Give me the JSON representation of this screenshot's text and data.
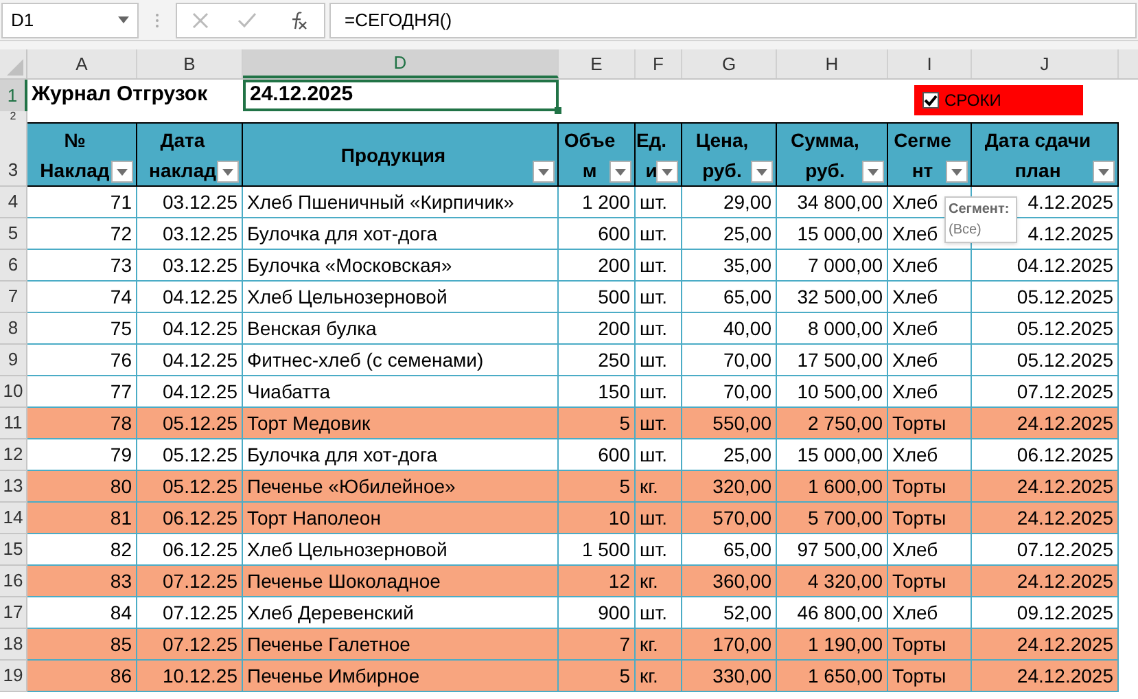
{
  "name_box": "D1",
  "formula": "=СЕГОДНЯ()",
  "column_headers": [
    {
      "label": "A",
      "selected": false
    },
    {
      "label": "B",
      "selected": false
    },
    {
      "label": "D",
      "selected": true
    },
    {
      "label": "E",
      "selected": false
    },
    {
      "label": "F",
      "selected": false
    },
    {
      "label": "G",
      "selected": false
    },
    {
      "label": "H",
      "selected": false
    },
    {
      "label": "I",
      "selected": false
    },
    {
      "label": "J",
      "selected": false
    }
  ],
  "title_row": {
    "row_number": "1",
    "selected": true,
    "title": "Журнал Отгрузок",
    "date": "24.12.2025"
  },
  "spacer_row": {
    "row_number": "2"
  },
  "checkbox": {
    "label": "СРОКИ",
    "checked": true
  },
  "table": {
    "header_row_number": "3",
    "columns": [
      "№\nНаклад",
      "Дата\nнаклад",
      "Продукция",
      "Объе\nм",
      "Ед.\nи",
      "Цена,\nруб.",
      "Сумма,\nруб.",
      "Сегме\nнт",
      "Дата сдачи\nплан"
    ],
    "rows": [
      {
        "row_number": "4",
        "highlighted": false,
        "cells": [
          "71",
          "03.12.25",
          "Хлеб Пшеничный «Кирпичик»",
          "1 200",
          "шт.",
          "29,00",
          "34 800,00",
          "Хлеб",
          "4.12.2025"
        ]
      },
      {
        "row_number": "5",
        "highlighted": false,
        "cells": [
          "72",
          "03.12.25",
          "Булочка для хот-дога",
          "600",
          "шт.",
          "25,00",
          "15 000,00",
          "Хлеб",
          "4.12.2025"
        ]
      },
      {
        "row_number": "6",
        "highlighted": false,
        "cells": [
          "73",
          "03.12.25",
          "Булочка «Московская»",
          "200",
          "шт.",
          "35,00",
          "7 000,00",
          "Хлеб",
          "04.12.2025"
        ]
      },
      {
        "row_number": "7",
        "highlighted": false,
        "cells": [
          "74",
          "04.12.25",
          "Хлеб Цельнозерновой",
          "500",
          "шт.",
          "65,00",
          "32 500,00",
          "Хлеб",
          "05.12.2025"
        ]
      },
      {
        "row_number": "8",
        "highlighted": false,
        "cells": [
          "75",
          "04.12.25",
          "Венская булка",
          "200",
          "шт.",
          "40,00",
          "8 000,00",
          "Хлеб",
          "05.12.2025"
        ]
      },
      {
        "row_number": "9",
        "highlighted": false,
        "cells": [
          "76",
          "04.12.25",
          "Фитнес-хлеб (с семенами)",
          "250",
          "шт.",
          "70,00",
          "17 500,00",
          "Хлеб",
          "05.12.2025"
        ]
      },
      {
        "row_number": "10",
        "highlighted": false,
        "cells": [
          "77",
          "04.12.25",
          "Чиабатта",
          "150",
          "шт.",
          "70,00",
          "10 500,00",
          "Хлеб",
          "07.12.2025"
        ]
      },
      {
        "row_number": "11",
        "highlighted": true,
        "cells": [
          "78",
          "05.12.25",
          "Торт Медовик",
          "5",
          "шт.",
          "550,00",
          "2 750,00",
          "Торты",
          "24.12.2025"
        ]
      },
      {
        "row_number": "12",
        "highlighted": false,
        "cells": [
          "79",
          "05.12.25",
          "Булочка для хот-дога",
          "600",
          "шт.",
          "25,00",
          "15 000,00",
          "Хлеб",
          "06.12.2025"
        ]
      },
      {
        "row_number": "13",
        "highlighted": true,
        "cells": [
          "80",
          "05.12.25",
          "Печенье «Юбилейное»",
          "5",
          "кг.",
          "320,00",
          "1 600,00",
          "Торты",
          "24.12.2025"
        ]
      },
      {
        "row_number": "14",
        "highlighted": true,
        "cells": [
          "81",
          "06.12.25",
          "Торт Наполеон",
          "10",
          "шт.",
          "570,00",
          "5 700,00",
          "Торты",
          "24.12.2025"
        ]
      },
      {
        "row_number": "15",
        "highlighted": false,
        "cells": [
          "82",
          "06.12.25",
          "Хлеб Цельнозерновой",
          "1 500",
          "шт.",
          "65,00",
          "97 500,00",
          "Хлеб",
          "07.12.2025"
        ]
      },
      {
        "row_number": "16",
        "highlighted": true,
        "cells": [
          "83",
          "07.12.25",
          "Печенье Шоколадное",
          "12",
          "кг.",
          "360,00",
          "4 320,00",
          "Торты",
          "24.12.2025"
        ]
      },
      {
        "row_number": "17",
        "highlighted": false,
        "cells": [
          "84",
          "07.12.25",
          "Хлеб Деревенский",
          "900",
          "шт.",
          "52,00",
          "46 800,00",
          "Хлеб",
          "09.12.2025"
        ]
      },
      {
        "row_number": "18",
        "highlighted": true,
        "cells": [
          "85",
          "07.12.25",
          "Печенье Галетное",
          "7",
          "кг.",
          "170,00",
          "1 190,00",
          "Торты",
          "24.12.2025"
        ]
      },
      {
        "row_number": "19",
        "highlighted": true,
        "cells": [
          "86",
          "10.12.25",
          "Печенье Имбирное",
          "5",
          "кг.",
          "330,00",
          "1 650,00",
          "Торты",
          "24.12.2025"
        ]
      }
    ]
  },
  "tooltip": {
    "title": "Сегмент:",
    "value": "(Все)"
  }
}
